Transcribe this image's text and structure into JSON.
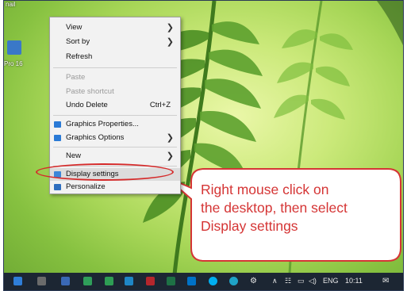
{
  "desktop": {
    "icon_labels": [
      "nail",
      "Pro 16"
    ]
  },
  "context_menu": {
    "items": [
      {
        "label": "View",
        "submenu": true
      },
      {
        "label": "Sort by",
        "submenu": true
      },
      {
        "label": "Refresh"
      },
      {
        "label": "Paste",
        "disabled": true
      },
      {
        "label": "Paste shortcut",
        "disabled": true
      },
      {
        "label": "Undo Delete",
        "shortcut": "Ctrl+Z"
      },
      {
        "label": "Graphics Properties..."
      },
      {
        "label": "Graphics Options",
        "submenu": true
      },
      {
        "label": "New",
        "submenu": true
      },
      {
        "label": "Display settings",
        "highlighted": true
      },
      {
        "label": "Personalize"
      }
    ]
  },
  "callout": {
    "text_line1": "Right mouse click on",
    "text_line2": "the desktop, then select",
    "text_line3": "Display settings",
    "color": "#d53535"
  },
  "taskbar": {
    "language": "ENG",
    "clock": "10:11"
  }
}
